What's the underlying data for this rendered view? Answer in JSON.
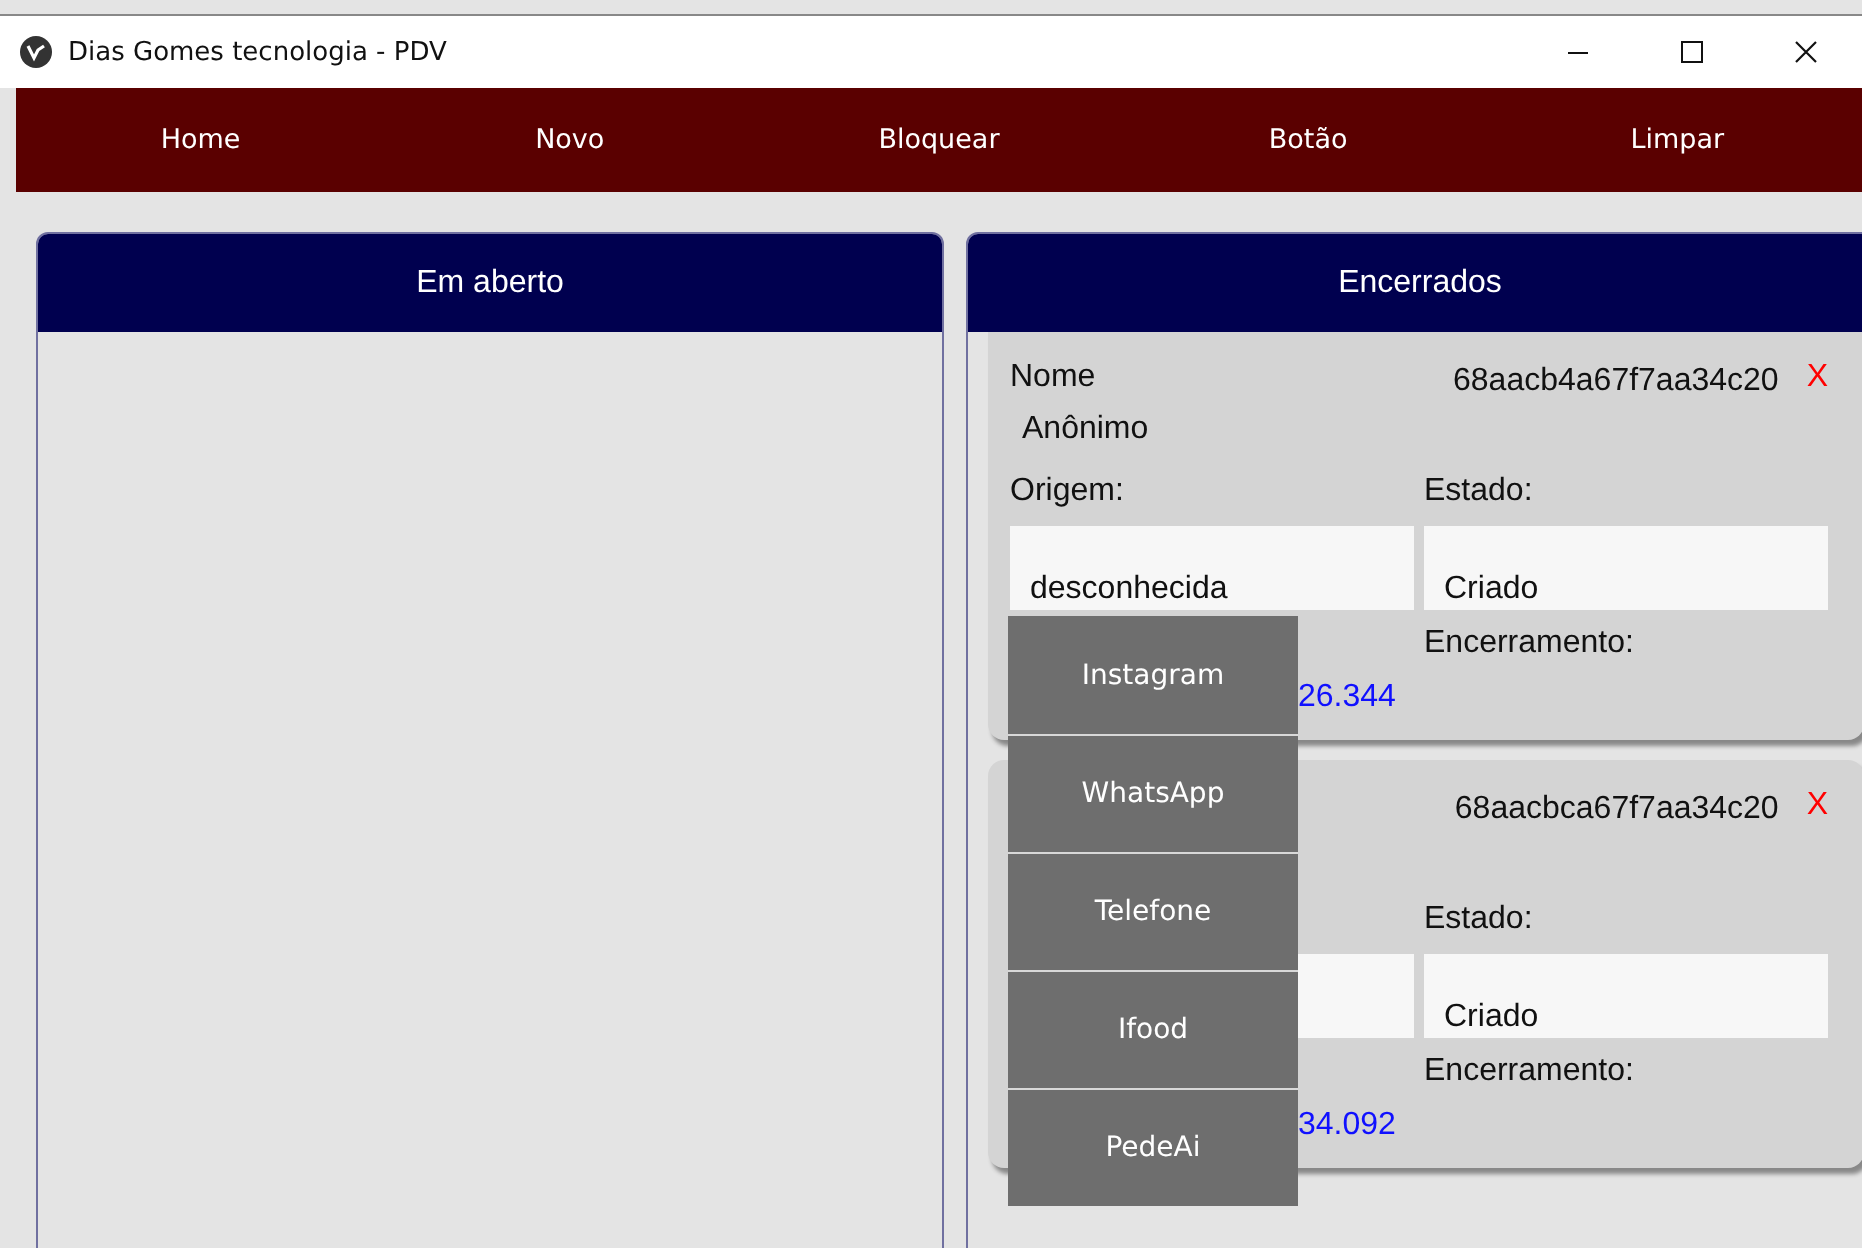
{
  "window": {
    "title": "Dias Gomes tecnologia - PDV"
  },
  "nav": [
    "Home",
    "Novo",
    "Bloquear",
    "Botão",
    "Limpar"
  ],
  "panels": [
    {
      "title": "Em aberto"
    },
    {
      "title": "Encerrados",
      "cards": [
        {
          "name_label": "Nome",
          "id": "68aacb4a67f7aa34c20",
          "close": "X",
          "name": "Anônimo",
          "origin_label": "Origem:",
          "origin": "desconhecida",
          "state_label": "Estado:",
          "state": "Criado",
          "created": "26.344",
          "closed_label": "Encerramento:"
        },
        {
          "id": "68aacbca67f7aa34c20",
          "close": "X",
          "state_label": "Estado:",
          "state": "Criado",
          "created": "34.092",
          "closed_label": "Encerramento:"
        }
      ]
    }
  ],
  "origin_menu": [
    "Instagram",
    "WhatsApp",
    "Telefone",
    "Ifood",
    "PedeAi"
  ]
}
